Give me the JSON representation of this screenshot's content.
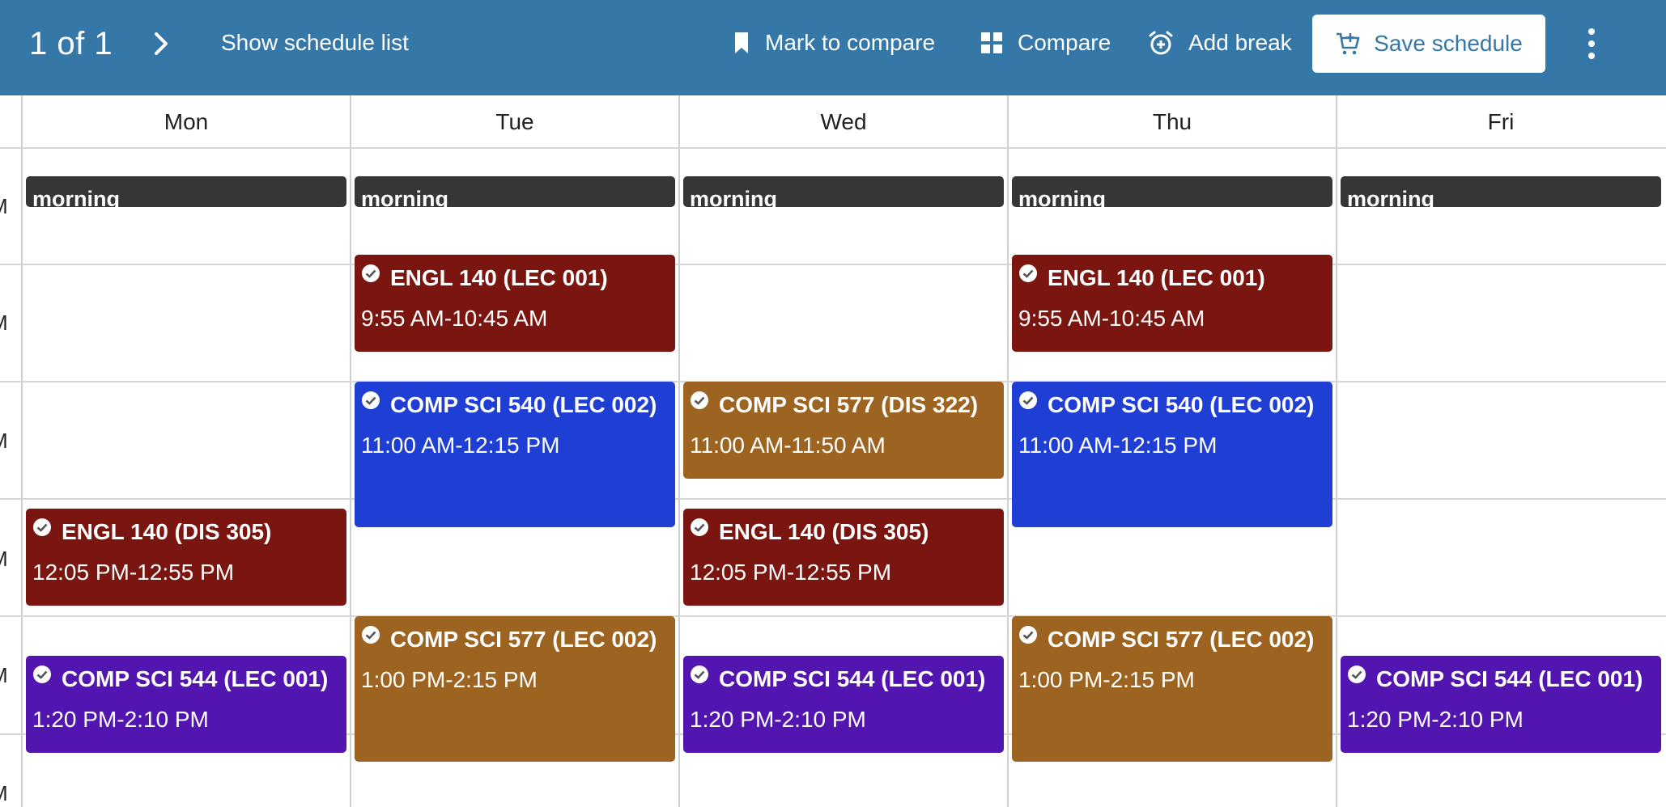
{
  "topbar": {
    "counter": "1 of 1",
    "show_list": "Show schedule list",
    "mark_compare": "Mark to compare",
    "compare": "Compare",
    "add_break": "Add break",
    "save": "Save schedule",
    "color": "#3578a8"
  },
  "days": [
    "Mon",
    "Tue",
    "Wed",
    "Thu",
    "Fri"
  ],
  "time_labels": [
    "M",
    "M",
    "M",
    "M",
    "M",
    "M"
  ],
  "breaks": [
    "morning",
    "morning",
    "morning",
    "morning",
    "morning"
  ],
  "events": [
    {
      "title": "ENGL 140 (LEC 001)",
      "time": "9:55 AM-10:45 AM",
      "color": "#7b1510"
    },
    {
      "title": "ENGL 140 (LEC 001)",
      "time": "9:55 AM-10:45 AM",
      "color": "#7b1510"
    },
    {
      "title": "COMP SCI 540 (LEC 002)",
      "time": "11:00 AM-12:15 PM",
      "color": "#1f3fd4"
    },
    {
      "title": "COMP SCI 577 (DIS 322)",
      "time": "11:00 AM-11:50 AM",
      "color": "#9c6420"
    },
    {
      "title": "COMP SCI 540 (LEC 002)",
      "time": "11:00 AM-12:15 PM",
      "color": "#1f3fd4"
    },
    {
      "title": "ENGL 140 (DIS 305)",
      "time": "12:05 PM-12:55 PM",
      "color": "#7b1510"
    },
    {
      "title": "ENGL 140 (DIS 305)",
      "time": "12:05 PM-12:55 PM",
      "color": "#7b1510"
    },
    {
      "title": "COMP SCI 577 (LEC 002)",
      "time": "1:00 PM-2:15 PM",
      "color": "#9c6420"
    },
    {
      "title": "COMP SCI 577 (LEC 002)",
      "time": "1:00 PM-2:15 PM",
      "color": "#9c6420"
    },
    {
      "title": "COMP SCI 544 (LEC 001)",
      "time": "1:20 PM-2:10 PM",
      "color": "#5215b0"
    },
    {
      "title": "COMP SCI 544 (LEC 001)",
      "time": "1:20 PM-2:10 PM",
      "color": "#5215b0"
    },
    {
      "title": "COMP SCI 544 (LEC 001)",
      "time": "1:20 PM-2:10 PM",
      "color": "#5215b0"
    }
  ]
}
